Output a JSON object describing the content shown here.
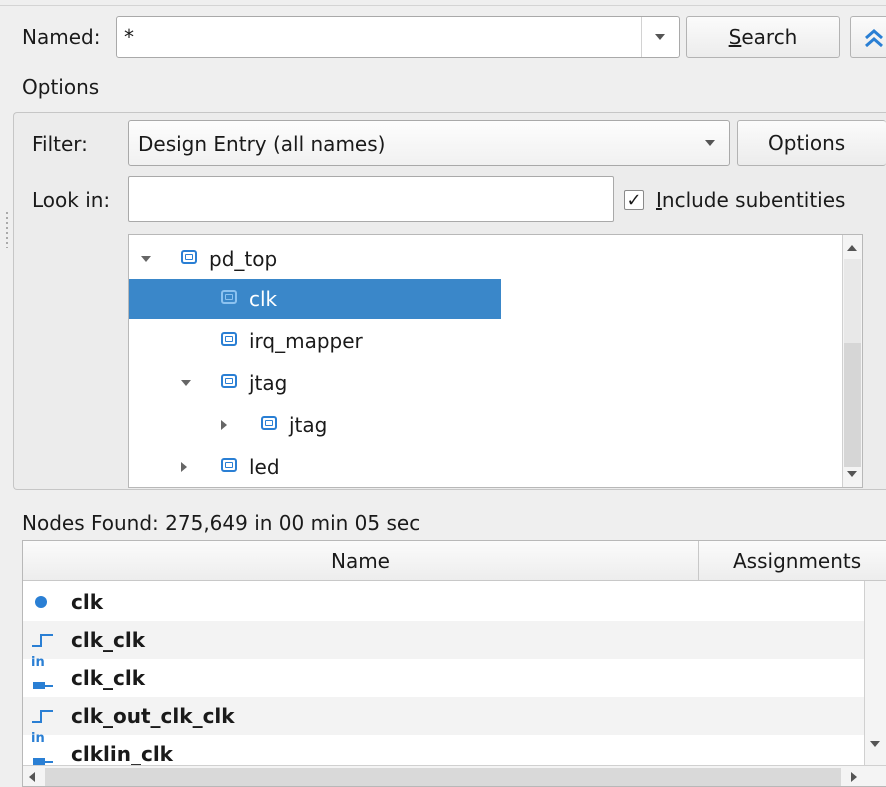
{
  "search_bar": {
    "named_label": "Named:",
    "named_value": "*",
    "search_label_mnemonic": "S",
    "search_label_rest": "earch",
    "collapse_icon": "double-chevron-up-icon"
  },
  "options": {
    "section_label": "Options",
    "filter_label": "Filter:",
    "filter_value": "Design Entry (all names)",
    "options_button": "Options",
    "look_in_label": "Look in:",
    "look_in_value": "",
    "include_subentities_mnemonic": "I",
    "include_subentities_rest": "nclude subentities",
    "include_subentities_checked": true,
    "check_glyph": "✓"
  },
  "tree": {
    "items": [
      {
        "label": "pd_top",
        "expander": "expanded",
        "selected": false
      },
      {
        "label": "clk",
        "expander": "none",
        "selected": true
      },
      {
        "label": "irq_mapper",
        "expander": "none",
        "selected": false
      },
      {
        "label": "jtag",
        "expander": "expanded",
        "selected": false
      },
      {
        "label": "jtag",
        "expander": "collapsed",
        "selected": false
      },
      {
        "label": "led",
        "expander": "collapsed",
        "selected": false
      }
    ]
  },
  "results": {
    "status": "Nodes Found: 275,649 in 00 min 05 sec",
    "columns": [
      "Name",
      "Assignments"
    ],
    "rows": [
      {
        "icon": "dot-icon",
        "name": "clk"
      },
      {
        "icon": "clock-edge-icon",
        "name": "clk_clk"
      },
      {
        "icon": "input-pin-icon",
        "name": "clk_clk"
      },
      {
        "icon": "clock-edge-icon",
        "name": "clk_out_clk_clk"
      },
      {
        "icon": "input-pin-icon",
        "name": "clklin_clk"
      }
    ],
    "input_pin_glyph": "in"
  },
  "colors": {
    "accent": "#2a7fd4",
    "selection": "#3a87c9",
    "background": "#efefef"
  }
}
